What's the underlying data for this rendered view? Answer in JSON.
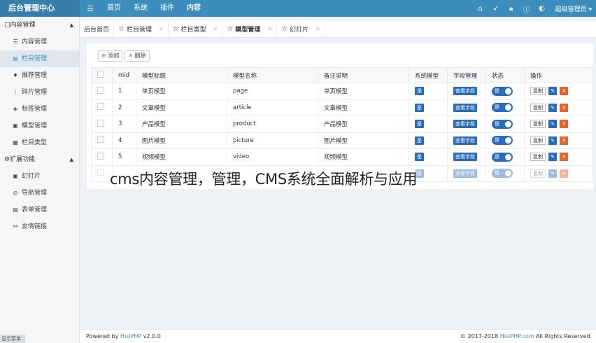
{
  "header": {
    "brand": "后台管理中心",
    "toggle_icon": "☰",
    "nav": [
      "首页",
      "系统",
      "插件",
      "内容"
    ],
    "user": "超级管理员 ▾"
  },
  "sidebar": {
    "group1": {
      "label": "内容管理",
      "icon": "▢"
    },
    "group1_items": [
      {
        "label": "内容管理",
        "icon": "☰"
      },
      {
        "label": "栏目管理",
        "icon": "▤"
      },
      {
        "label": "推荐管理",
        "icon": "♦"
      },
      {
        "label": "碎片管理",
        "icon": "⁝"
      },
      {
        "label": "标签管理",
        "icon": "◈"
      },
      {
        "label": "模型管理",
        "icon": "▣"
      },
      {
        "label": "栏目类型",
        "icon": "▦"
      }
    ],
    "group2": {
      "label": "扩展功能",
      "icon": "⚙"
    },
    "group2_items": [
      {
        "label": "幻灯片",
        "icon": "▣"
      },
      {
        "label": "导航管理",
        "icon": "◎"
      },
      {
        "label": "表单管理",
        "icon": "▤"
      },
      {
        "label": "友情链接",
        "icon": "⚯"
      }
    ],
    "footer_label": "显示菜单"
  },
  "tabs": [
    {
      "label": "后台首页"
    },
    {
      "label": "栏目管理"
    },
    {
      "label": "栏目类型"
    },
    {
      "label": "模型管理"
    },
    {
      "label": "幻灯片"
    }
  ],
  "toolbar": {
    "add_label": "添加",
    "delete_label": "删除"
  },
  "table": {
    "headers": [
      "mid",
      "模型标题",
      "模型名称",
      "备注说明",
      "系统模型",
      "字段管理",
      "状态",
      "操作"
    ],
    "rows": [
      {
        "mid": "1",
        "title": "单页模型",
        "name": "page",
        "note": "单页模型"
      },
      {
        "mid": "2",
        "title": "文章模型",
        "name": "article",
        "note": "文章模型"
      },
      {
        "mid": "3",
        "title": "产品模型",
        "name": "product",
        "note": "产品模型"
      },
      {
        "mid": "4",
        "title": "图片模型",
        "name": "picture",
        "note": "图片模型"
      },
      {
        "mid": "5",
        "title": "视频模型",
        "name": "video",
        "note": "视频模型"
      },
      {
        "mid": "",
        "title": "",
        "name": "",
        "note": ""
      }
    ],
    "system_label": "是",
    "field_label": "查看字段",
    "status_label": "是",
    "copy_label": "复制",
    "edit_icon": "✎",
    "delete_icon": "✕"
  },
  "watermark": "cms内容管理，管理，CMS系统全面解析与应用",
  "footer": {
    "powered": "Powered by",
    "product": "HisiPHP",
    "version": "v2.0.0",
    "copyright_prefix": "© 2017-2018",
    "copyright_link": "HisiPHP.com",
    "copyright_suffix": "All Rights Reserved."
  },
  "colors": {
    "accent": "#3c8dbc",
    "primary": "#2b6cb8",
    "danger": "#e8642e"
  }
}
